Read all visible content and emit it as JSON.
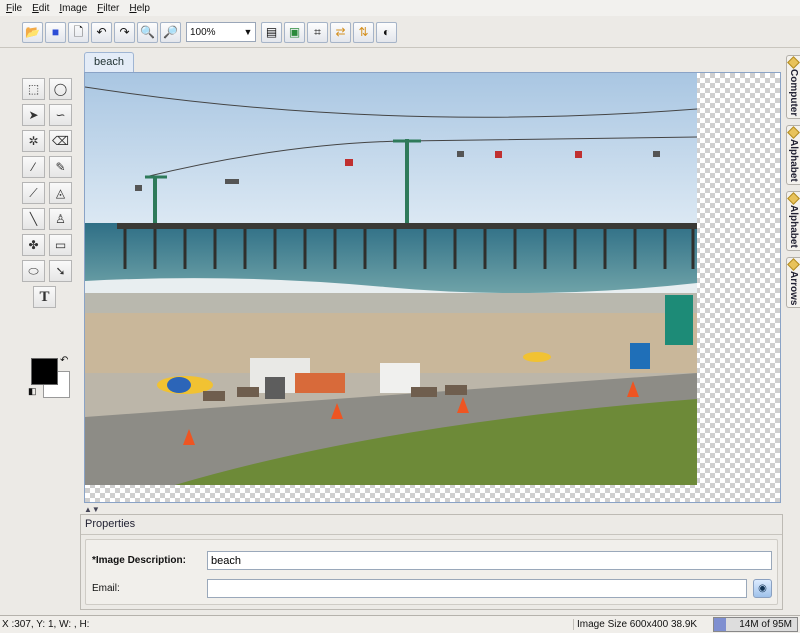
{
  "menu": [
    "File",
    "Edit",
    "Image",
    "Filter",
    "Help"
  ],
  "toolbar": {
    "buttons": [
      "open-icon",
      "save-icon",
      "new-icon",
      "undo-icon",
      "redo-icon",
      "zoom-in-icon",
      "zoom-out-icon"
    ],
    "zoom_value": "100%",
    "right_buttons": [
      "fit-page-icon",
      "adjust-icon",
      "crop-icon",
      "flip-horizontal-icon",
      "flip-vertical-icon",
      "contrast-icon"
    ]
  },
  "document_tab": "beach",
  "tools": [
    [
      "rectangle-select-icon",
      "ellipse-select-icon"
    ],
    [
      "move-icon",
      "lasso-icon"
    ],
    [
      "magic-wand-icon",
      "eraser-icon"
    ],
    [
      "color-picker-icon",
      "pencil-icon"
    ],
    [
      "brush-icon",
      "paint-bucket-icon"
    ],
    [
      "line-icon",
      "stamp-icon"
    ],
    [
      "effects-icon",
      "rectangle-shape-icon"
    ],
    [
      "ellipse-shape-icon",
      "arrow-shape-icon"
    ]
  ],
  "type_tool_label": "T",
  "colors": {
    "foreground": "#000000",
    "background": "#ffffff"
  },
  "properties": {
    "title": "Properties",
    "description_label": "*Image Description:",
    "description_value": "beach",
    "email_label": "Email:",
    "email_value": ""
  },
  "side_tabs": [
    "Computer",
    "Alphabet",
    "Alphabet",
    "Arrows"
  ],
  "status": {
    "coords": "X :307, Y: 1, W: , H:",
    "image_info": "Image Size 600x400  38.9K",
    "memory": "14M of 95M",
    "memory_fraction": 0.15
  }
}
